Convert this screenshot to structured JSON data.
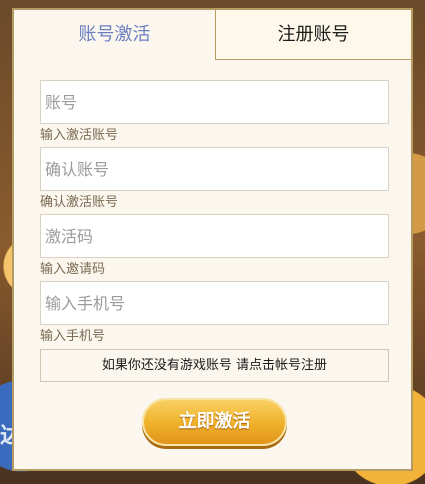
{
  "tabs": {
    "activate": "账号激活",
    "register": "注册账号"
  },
  "form": {
    "account": {
      "placeholder": "账号",
      "hint": "输入激活账号"
    },
    "confirm_account": {
      "placeholder": "确认账号",
      "hint": "确认激活账号"
    },
    "activation_code": {
      "placeholder": "激活码",
      "hint": "输入邀请码"
    },
    "phone": {
      "placeholder": "输入手机号",
      "hint": "输入手机号"
    }
  },
  "register_prompt": "如果你还没有游戏账号 请点击帐号注册",
  "activate_button": "立即激活",
  "background": {
    "glyph": "达"
  },
  "colors": {
    "active_tab": "#6b7fc2",
    "panel_bg": "#fbf7ee",
    "panel_border": "#b59a62",
    "button_gold": "#f0b32c"
  }
}
